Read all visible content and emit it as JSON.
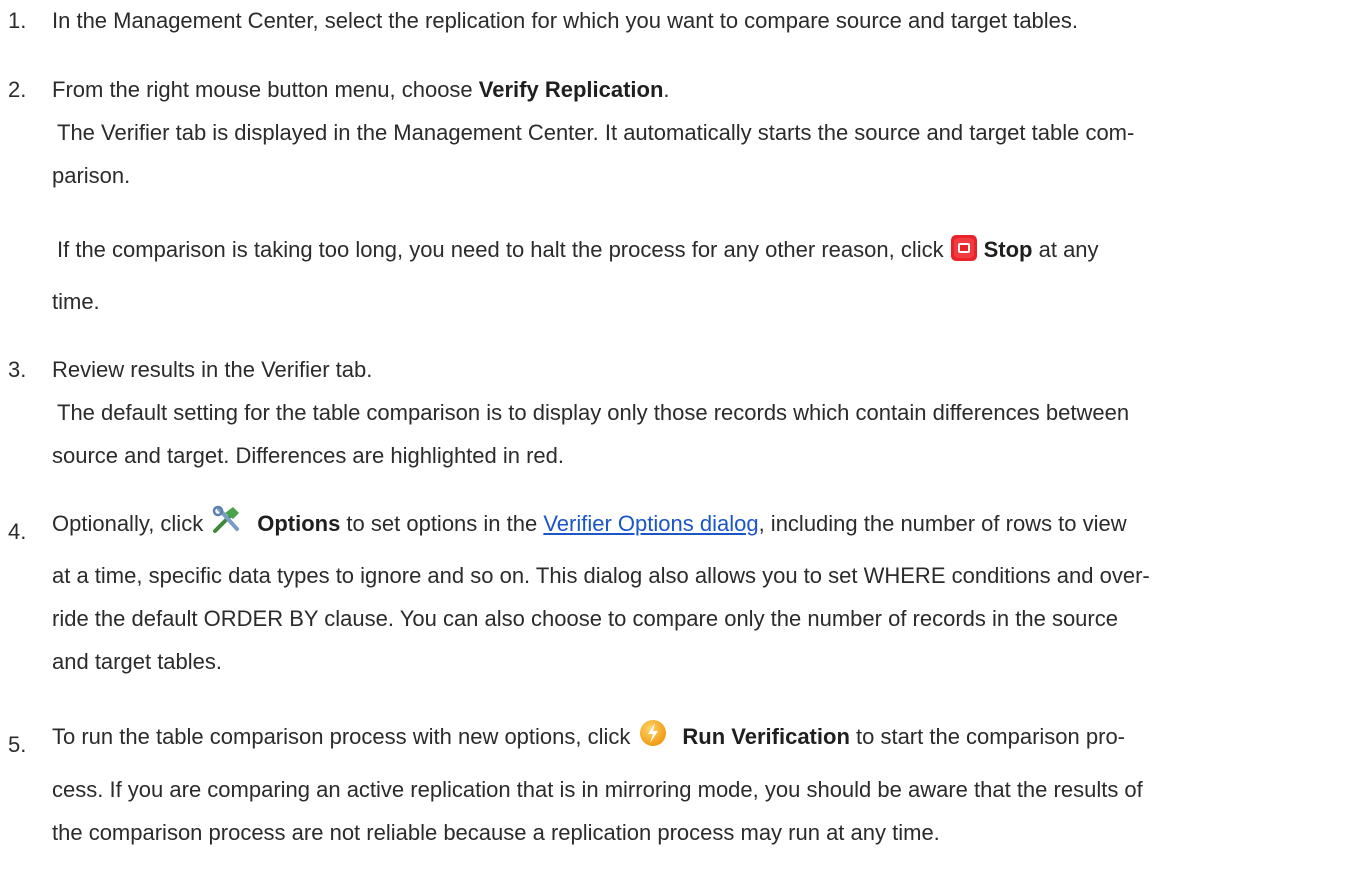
{
  "steps": [
    {
      "number": "1.",
      "text": "In the Management Center, select the replication for which you want to compare source and target tables."
    },
    {
      "number": "2.",
      "line1_prefix": "From the right mouse button menu, choose ",
      "line1_bold": "Verify Replication",
      "line1_suffix": ".",
      "line2": "The Verifier tab is displayed in the Management Center.  It automatically starts the source and target table com-",
      "line3": "parison.",
      "line4_prefix": "If the comparison is taking too long, you need to halt the process for any other reason, click",
      "line4_bold": "Stop",
      "line4_suffix": " at any",
      "line5": "time."
    },
    {
      "number": "3.",
      "line1": "Review results in the Verifier tab.",
      "line2": "The default setting for the table comparison is to display only those records which contain differences between",
      "line3": "source and target. Differences are highlighted in red."
    },
    {
      "number": "4.",
      "line1_prefix": "Optionally, click",
      "line1_bold": "Options",
      "line1_mid": " to set options in the ",
      "line1_link": "Verifier Options dialog",
      "line1_suffix": ", including the number of rows to view",
      "line2": "at a time, specific data types to ignore and so on. This dialog also allows you to set WHERE conditions and over-",
      "line3": "ride the default ORDER BY clause. You can also choose to compare only the number of records in the source",
      "line4": "and target tables."
    },
    {
      "number": "5.",
      "line1_prefix": "To run the table comparison process with new options, click",
      "line1_bold": "Run Verification",
      "line1_suffix": " to start the comparison pro-",
      "line2": "cess. If you are comparing an active replication that is in mirroring mode, you should be aware that the results of",
      "line3": "the comparison process are not reliable because a replication process may run at any time."
    }
  ],
  "icons": {
    "stop": "stop-icon",
    "options": "tools-icon",
    "run": "lightning-run-icon"
  },
  "colors": {
    "text": "#2b2b2b",
    "link": "#1a55c9",
    "stop_red": "#e8232a",
    "run_orange": "#f5a623",
    "tools_green": "#3d8b3a"
  }
}
